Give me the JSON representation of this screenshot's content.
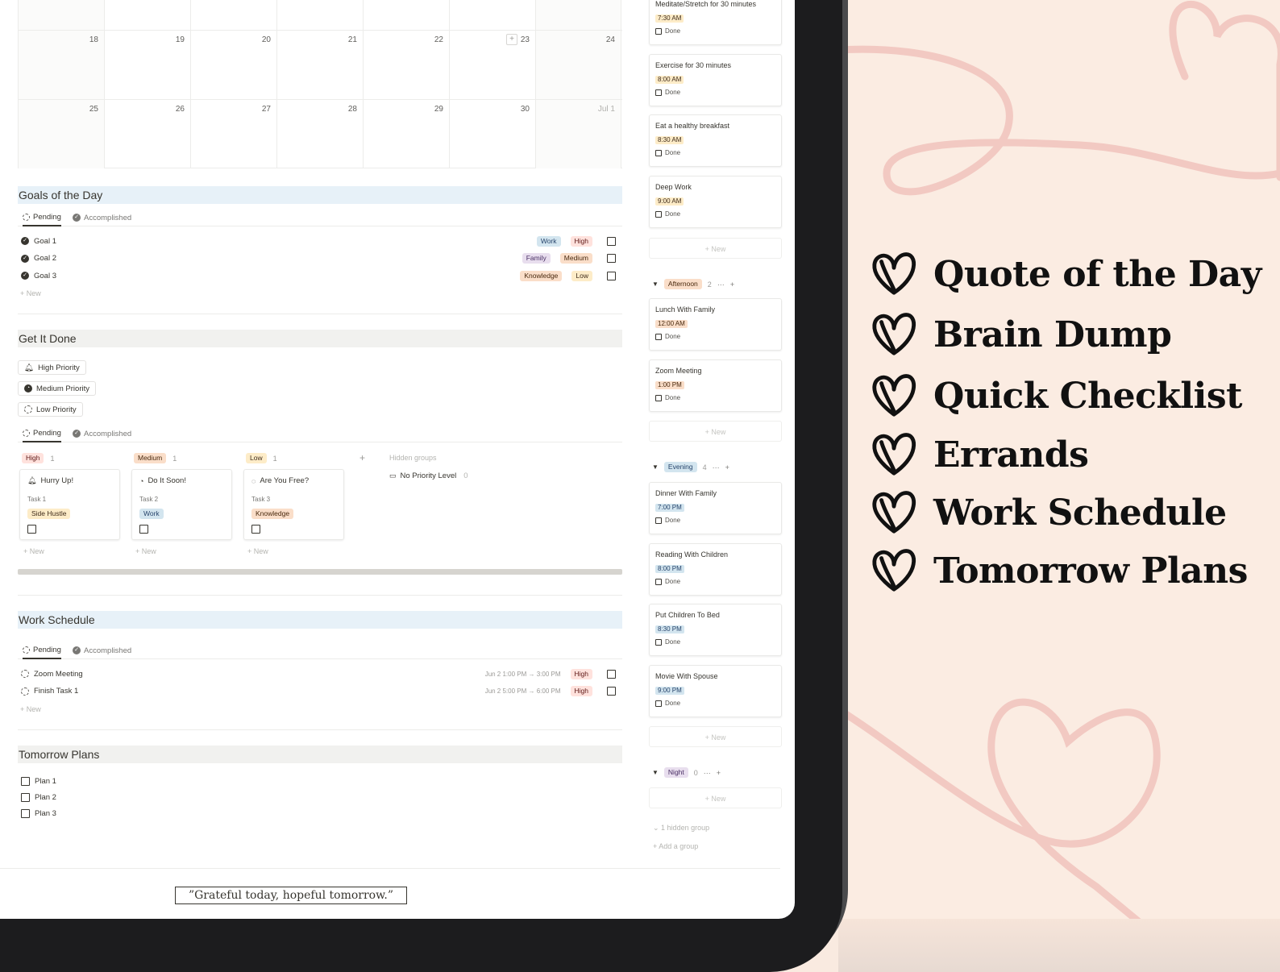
{
  "calendar": {
    "rows": [
      [
        "",
        "",
        "",
        "",
        "",
        "",
        ""
      ],
      [
        "18",
        "19",
        "20",
        "21",
        "22",
        "23",
        "24"
      ],
      [
        "25",
        "26",
        "27",
        "28",
        "29",
        "30",
        "Jul 1"
      ]
    ]
  },
  "goals": {
    "title": "Goals of the Day",
    "tabs": [
      "Pending",
      "Accomplished"
    ],
    "items": [
      {
        "label": "Goal 1",
        "category": "Work",
        "priority": "High"
      },
      {
        "label": "Goal 2",
        "category": "Family",
        "priority": "Medium"
      },
      {
        "label": "Goal 3",
        "category": "Knowledge",
        "priority": "Low"
      }
    ],
    "new_label": "New"
  },
  "get_it_done": {
    "title": "Get It Done",
    "buttons": [
      "High Priority",
      "Medium Priority",
      "Low Priority"
    ],
    "tabs": [
      "Pending",
      "Accomplished"
    ],
    "groups": [
      {
        "name": "High",
        "count": "1",
        "card_title": "Hurry Up!",
        "task": "Task 1",
        "tag": "Side Hustle"
      },
      {
        "name": "Medium",
        "count": "1",
        "card_title": "Do It Soon!",
        "task": "Task 2",
        "tag": "Work"
      },
      {
        "name": "Low",
        "count": "1",
        "card_title": "Are You Free?",
        "task": "Task 3",
        "tag": "Knowledge"
      }
    ],
    "hidden_groups_label": "Hidden groups",
    "no_priority_label": "No Priority Level",
    "no_priority_count": "0",
    "new_label": "New"
  },
  "work_schedule": {
    "title": "Work Schedule",
    "tabs": [
      "Pending",
      "Accomplished"
    ],
    "items": [
      {
        "label": "Zoom Meeting",
        "time": "Jun 2 1:00 PM → 3:00 PM",
        "priority": "High"
      },
      {
        "label": "Finish Task 1",
        "time": "Jun 2 5:00 PM → 6:00 PM",
        "priority": "High"
      }
    ],
    "new_label": "New"
  },
  "tomorrow": {
    "title": "Tomorrow Plans",
    "items": [
      "Plan 1",
      "Plan 2",
      "Plan 3"
    ]
  },
  "quote": "”Grateful today, hopeful tomorrow.”",
  "schedule": {
    "morning_cards": [
      {
        "title": "Meditate/Stretch for 30 minutes",
        "time": "7:30 AM"
      },
      {
        "title": "Exercise for 30 minutes",
        "time": "8:00 AM"
      },
      {
        "title": "Eat a healthy breakfast",
        "time": "8:30 AM"
      },
      {
        "title": "Deep Work",
        "time": "9:00 AM"
      }
    ],
    "afternoon": {
      "name": "Afternoon",
      "count": "2",
      "cards": [
        {
          "title": "Lunch With Family",
          "time": "12:00 AM"
        },
        {
          "title": "Zoom Meeting",
          "time": "1:00 PM"
        }
      ]
    },
    "evening": {
      "name": "Evening",
      "count": "4",
      "cards": [
        {
          "title": "Dinner With Family",
          "time": "7:00 PM"
        },
        {
          "title": "Reading With Children",
          "time": "8:00 PM"
        },
        {
          "title": "Put Children To Bed",
          "time": "8:30 PM"
        },
        {
          "title": "Movie With Spouse",
          "time": "9:00 PM"
        }
      ]
    },
    "night": {
      "name": "Night",
      "count": "0"
    },
    "done_label": "Done",
    "new_label": "New",
    "hidden_group_label": "1 hidden group",
    "add_group_label": "Add a group"
  },
  "features": [
    "Quote of  the Day",
    "Brain Dump",
    "Quick Checklist",
    "Errands",
    "Work Schedule",
    "Tomorrow Plans"
  ],
  "colors": {
    "heart_stroke": "#111111",
    "decor_line": "#f0c3bd",
    "background": "#fbece2"
  }
}
